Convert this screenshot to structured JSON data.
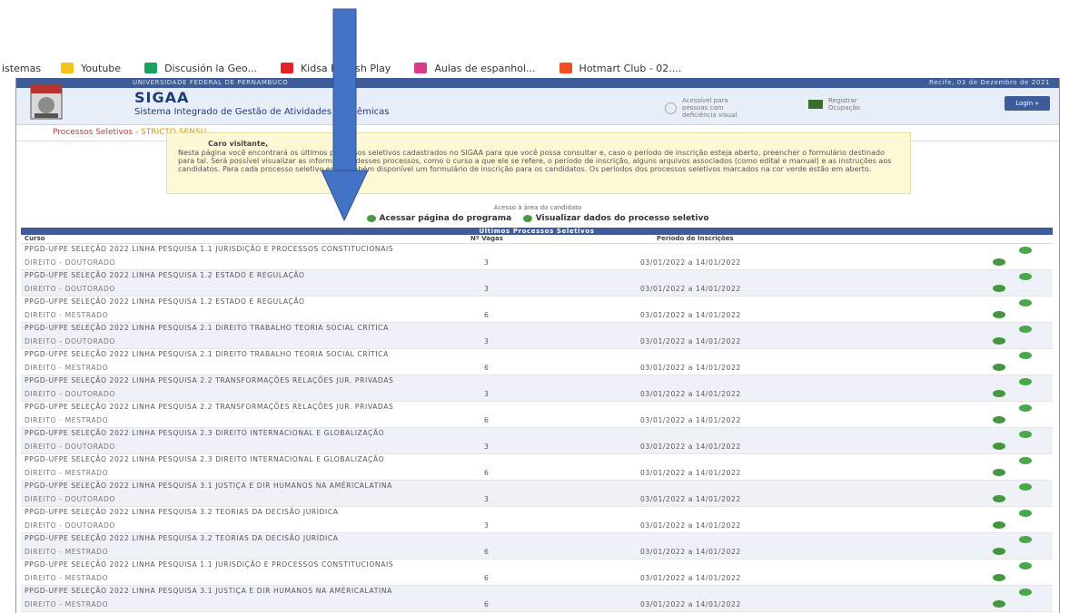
{
  "bookmarks": [
    {
      "label": "istemas",
      "icon": "none",
      "color": ""
    },
    {
      "label": "Youtube",
      "icon": "folder-icon",
      "color": "#f2c318"
    },
    {
      "label": "Discusión la Geo...",
      "icon": "drive-icon",
      "color": "#1aa260"
    },
    {
      "label": "Kidsa English Play",
      "icon": "kidsa-icon",
      "color": "#e32129"
    },
    {
      "label": "Aulas de espanhol...",
      "icon": "aulas-icon",
      "color": "#d93a8a"
    },
    {
      "label": "Hotmart Club - 02....",
      "icon": "hotmart-icon",
      "color": "#f04e23"
    }
  ],
  "topbar": {
    "left": "UNIVERSIDADE FEDERAL DE PERNAMBUCO",
    "right": "Recife, 03 de Dezembro de 2021"
  },
  "header": {
    "title": "SIGAA",
    "subtitle": "Sistema Integrado de Gestão de Atividades Acadêmicas",
    "accessible_text": "Acessível para pessoas com deficiência visual",
    "register_text": "Registrar Ocupação",
    "login_label": "Login  »"
  },
  "breadcrumb": {
    "part1": "Processos Seletivos",
    "sep": " - ",
    "part2": "STRICTO SENSU"
  },
  "notice": {
    "title": "Caro visitante,",
    "body": "Nesta página você encontrará os últimos processos seletivos cadastrados no SIGAA para que você possa consultar e, caso o período de inscrição esteja aberto, preencher o formulário destinado para tal. Será possível visualizar as informações desses processos, como o curso a que ele se refere, o período de inscrição, alguns arquivos associados (como edital e manual) e as instruções aos candidatos. Para cada processo seletivo está também disponível um formulário de inscrição para os candidatos. Os períodos dos processos seletivos marcados na cor verde estão em aberto."
  },
  "legend": {
    "title": "Acesso à área do candidato",
    "item1": "Acessar página do programa",
    "item2": "Visualizar dados do processo seletivo"
  },
  "table": {
    "title": "Últimos Processos Seletivos",
    "col_curso": "Curso",
    "col_vagas": "Nº Vagas",
    "col_periodo": "Período de Inscrições",
    "rows": [
      {
        "name": "PPGD-UFPE SELEÇÃO 2022 LINHA PESQUISA 1.1 JURISDIÇÃO E PROCESSOS CONSTITUCIONAIS",
        "course": "DIREITO - DOUTORADO",
        "vagas": "3",
        "periodo": "03/01/2022 a 14/01/2022"
      },
      {
        "name": "PPGD-UFPE SELEÇÃO 2022 LINHA PESQUISA 1.2 ESTADO E REGULAÇÃO",
        "course": "DIREITO - DOUTORADO",
        "vagas": "3",
        "periodo": "03/01/2022 a 14/01/2022"
      },
      {
        "name": "PPGD-UFPE SELEÇÃO 2022 LINHA PESQUISA 1.2 ESTADO E REGULAÇÃO",
        "course": "DIREITO - MESTRADO",
        "vagas": "6",
        "periodo": "03/01/2022 a 14/01/2022"
      },
      {
        "name": "PPGD-UFPE SELEÇÃO 2022 LINHA PESQUISA 2.1 DIREITO TRABALHO TEORIA SOCIAL CRÍTICA",
        "course": "DIREITO - DOUTORADO",
        "vagas": "3",
        "periodo": "03/01/2022 a 14/01/2022"
      },
      {
        "name": "PPGD-UFPE SELEÇÃO 2022 LINHA PESQUISA 2.1 DIREITO TRABALHO TEORIA SOCIAL CRÍTICA",
        "course": "DIREITO - MESTRADO",
        "vagas": "6",
        "periodo": "03/01/2022 a 14/01/2022"
      },
      {
        "name": "PPGD-UFPE SELEÇÃO 2022 LINHA PESQUISA 2.2 TRANSFORMAÇÕES RELAÇÕES JUR. PRIVADAS",
        "course": "DIREITO - DOUTORADO",
        "vagas": "3",
        "periodo": "03/01/2022 a 14/01/2022"
      },
      {
        "name": "PPGD-UFPE SELEÇÃO 2022 LINHA PESQUISA 2.2 TRANSFORMAÇÕES RELAÇÕES JUR. PRIVADAS",
        "course": "DIREITO - MESTRADO",
        "vagas": "6",
        "periodo": "03/01/2022 a 14/01/2022"
      },
      {
        "name": "PPGD-UFPE SELEÇÃO 2022 LINHA PESQUISA 2.3 DIREITO INTERNACIONAL E GLOBALIZAÇÃO",
        "course": "DIREITO - DOUTORADO",
        "vagas": "3",
        "periodo": "03/01/2022 a 14/01/2022"
      },
      {
        "name": "PPGD-UFPE SELEÇÃO 2022 LINHA PESQUISA 2.3 DIREITO INTERNACIONAL E GLOBALIZAÇÃO",
        "course": "DIREITO - MESTRADO",
        "vagas": "6",
        "periodo": "03/01/2022 a 14/01/2022"
      },
      {
        "name": "PPGD-UFPE SELEÇÃO 2022 LINHA PESQUISA 3.1 JUSTIÇA E DIR HUMANOS NA AMÉRICALATINA",
        "course": "DIREITO - DOUTORADO",
        "vagas": "3",
        "periodo": "03/01/2022 a 14/01/2022"
      },
      {
        "name": "PPGD-UFPE SELEÇÃO 2022 LINHA PESQUISA 3.2 TEORIAS DA DECISÃO JURÍDICA",
        "course": "DIREITO - DOUTORADO",
        "vagas": "3",
        "periodo": "03/01/2022 a 14/01/2022"
      },
      {
        "name": "PPGD-UFPE SELEÇÃO 2022 LINHA PESQUISA 3.2 TEORIAS DA DECISÃO JURÍDICA",
        "course": "DIREITO - MESTRADO",
        "vagas": "6",
        "periodo": "03/01/2022 a 14/01/2022"
      },
      {
        "name": "PPGD-UFPE SELEÇÃO 2022 LINHA PESQUISA 1.1 JURISDIÇÃO E PROCESSOS CONSTITUCIONAIS",
        "course": "DIREITO - MESTRADO",
        "vagas": "6",
        "periodo": "03/01/2022 a 14/01/2022"
      },
      {
        "name": "PPGD-UFPE SELEÇÃO 2022 LINHA PESQUISA 3.1 JUSTIÇA E DIR HUMANOS NA AMÉRICALATINA",
        "course": "DIREITO - MESTRADO",
        "vagas": "6",
        "periodo": "03/01/2022 a 14/01/2022"
      }
    ]
  },
  "colors": {
    "brand_blue": "#3e5c99",
    "arrow_blue": "#4472c4",
    "open_green": "#45973f"
  }
}
